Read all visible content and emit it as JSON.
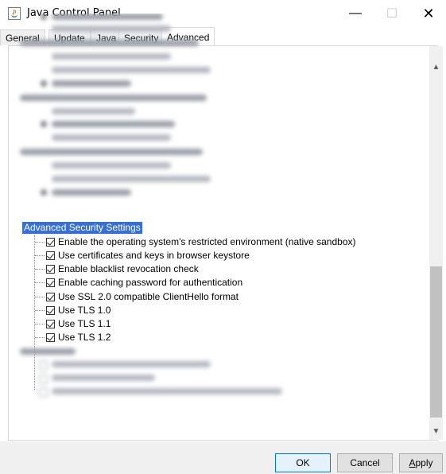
{
  "window": {
    "title": "Java Control Panel",
    "minimize_glyph": "—",
    "maximize_glyph": "☐",
    "close_glyph": "✕"
  },
  "tabs": [
    {
      "label": "General",
      "active": false
    },
    {
      "label": "Update",
      "active": false
    },
    {
      "label": "Java",
      "active": false
    },
    {
      "label": "Security",
      "active": false
    },
    {
      "label": "Advanced",
      "active": true
    }
  ],
  "advanced_security": {
    "header": "Advanced Security Settings",
    "items": [
      {
        "label": "Enable the operating system's restricted environment (native sandbox)",
        "checked": true
      },
      {
        "label": "Use certificates and keys in browser keystore",
        "checked": true
      },
      {
        "label": "Enable blacklist revocation check",
        "checked": true
      },
      {
        "label": "Enable caching password for authentication",
        "checked": true
      },
      {
        "label": "Use SSL 2.0 compatible ClientHello format",
        "checked": true
      },
      {
        "label": "Use TLS 1.0",
        "checked": true
      },
      {
        "label": "Use TLS 1.1",
        "checked": true
      },
      {
        "label": "Use TLS 1.2",
        "checked": true
      }
    ]
  },
  "buttons": {
    "ok": "OK",
    "cancel": "Cancel",
    "apply_first": "A",
    "apply_rest": "pply"
  },
  "icons": {
    "app": "java-cup-icon",
    "scroll_up": "chevron-up-icon",
    "scroll_down": "chevron-down-icon"
  },
  "colors": {
    "selection": "#3670d6",
    "default_button_border": "#0078d7"
  }
}
